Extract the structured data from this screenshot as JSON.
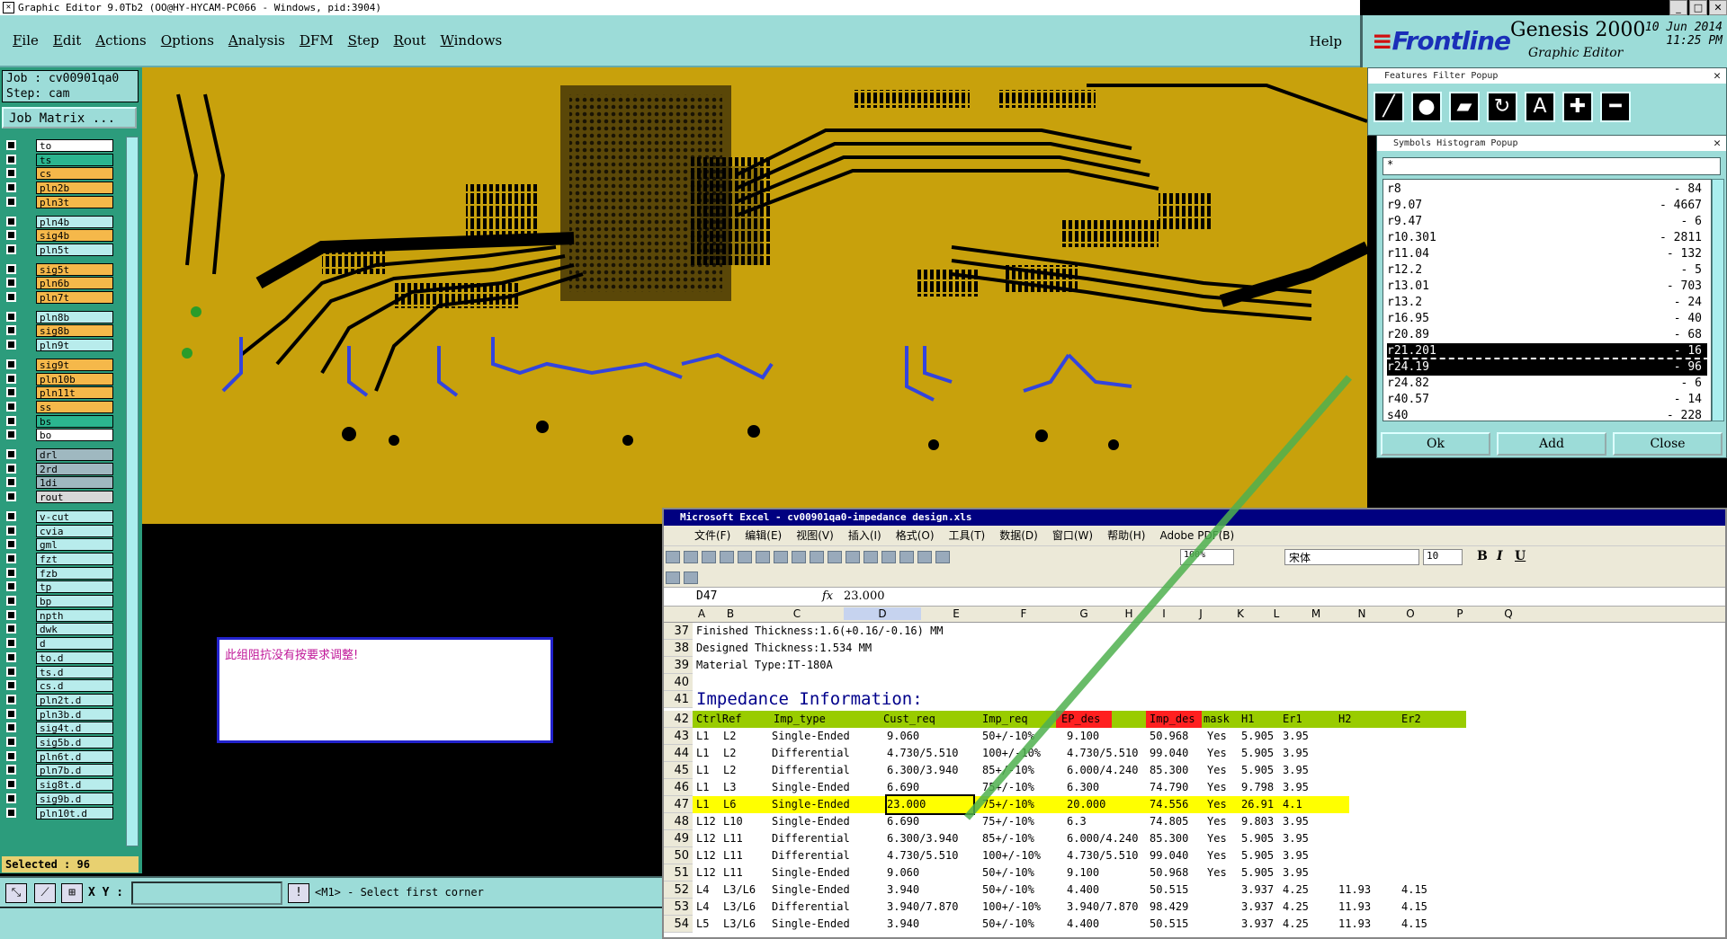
{
  "app": {
    "title": "Graphic Editor 9.0Tb2 (OO@HY-HYCAM-PC066 - Windows, pid:3904)",
    "menu": [
      "File",
      "Edit",
      "Actions",
      "Options",
      "Analysis",
      "DFM",
      "Step",
      "Rout",
      "Windows"
    ],
    "help": "Help"
  },
  "brand": {
    "logo": "Frontline",
    "product": "Genesis 2000",
    "subtitle": "Graphic Editor",
    "date": "10 Jun 2014",
    "time": "11:25 PM"
  },
  "job": {
    "job_label": "Job : cv00901qa0",
    "step_label": "Step: cam",
    "matrix_button": "Job Matrix ..."
  },
  "layers": [
    {
      "name": "to",
      "color": "#ffffff"
    },
    {
      "name": "ts",
      "color": "#2bb58f"
    },
    {
      "name": "cs",
      "color": "#f5b84a"
    },
    {
      "name": "pln2b",
      "color": "#f5b84a"
    },
    {
      "name": "pln3t",
      "color": "#f5b84a"
    },
    {
      "name": "pln4b",
      "color": "#b8ecec"
    },
    {
      "name": "sig4b",
      "color": "#f5b84a"
    },
    {
      "name": "pln5t",
      "color": "#b8ecec"
    },
    {
      "name": "sig5t",
      "color": "#f5b84a"
    },
    {
      "name": "pln6b",
      "color": "#f5b84a"
    },
    {
      "name": "pln7t",
      "color": "#f5b84a"
    },
    {
      "name": "pln8b",
      "color": "#b8ecec"
    },
    {
      "name": "sig8b",
      "color": "#f5b84a"
    },
    {
      "name": "pln9t",
      "color": "#b8ecec"
    },
    {
      "name": "sig9t",
      "color": "#f5b84a"
    },
    {
      "name": "pln10b",
      "color": "#f5b84a"
    },
    {
      "name": "pln11t",
      "color": "#f5b84a"
    },
    {
      "name": "ss",
      "color": "#f5b84a"
    },
    {
      "name": "bs",
      "color": "#2bb58f"
    },
    {
      "name": "bo",
      "color": "#ffffff"
    },
    {
      "name": "drl",
      "color": "#9fb8c0"
    },
    {
      "name": "2rd",
      "color": "#9fb8c0"
    },
    {
      "name": "1di",
      "color": "#9fb8c0"
    },
    {
      "name": "rout",
      "color": "#d8d8d8"
    },
    {
      "name": "v-cut",
      "color": "#b8ecec"
    },
    {
      "name": "cvia",
      "color": "#b8ecec"
    },
    {
      "name": "gml",
      "color": "#b8ecec"
    },
    {
      "name": "fzt",
      "color": "#b8ecec"
    },
    {
      "name": "fzb",
      "color": "#b8ecec"
    },
    {
      "name": "tp",
      "color": "#b8ecec"
    },
    {
      "name": "bp",
      "color": "#b8ecec"
    },
    {
      "name": "npth",
      "color": "#b8ecec"
    },
    {
      "name": "dwk",
      "color": "#b8ecec"
    },
    {
      "name": "d",
      "color": "#b8ecec"
    },
    {
      "name": "to.d",
      "color": "#b8ecec"
    },
    {
      "name": "ts.d",
      "color": "#b8ecec"
    },
    {
      "name": "cs.d",
      "color": "#b8ecec"
    },
    {
      "name": "pln2t.d",
      "color": "#b8ecec"
    },
    {
      "name": "pln3b.d",
      "color": "#b8ecec"
    },
    {
      "name": "sig4t.d",
      "color": "#b8ecec"
    },
    {
      "name": "sig5b.d",
      "color": "#b8ecec"
    },
    {
      "name": "pln6t.d",
      "color": "#b8ecec"
    },
    {
      "name": "pln7b.d",
      "color": "#b8ecec"
    },
    {
      "name": "sig8t.d",
      "color": "#b8ecec"
    },
    {
      "name": "sig9b.d",
      "color": "#b8ecec"
    },
    {
      "name": "pln10t.d",
      "color": "#b8ecec"
    }
  ],
  "selected": "Selected : 96",
  "bottom": {
    "xy_label": "X Y :",
    "message": "<M1> - Select first corner"
  },
  "note": "此组阻抗没有按要求调整!",
  "features_popup": {
    "title": "Features Filter Popup"
  },
  "symbols_popup": {
    "title": "Symbols Histogram Popup",
    "filter": "*",
    "rows": [
      {
        "sym": "r8",
        "count": "- 84"
      },
      {
        "sym": "r9.07",
        "count": "- 4667"
      },
      {
        "sym": "r9.47",
        "count": "- 6"
      },
      {
        "sym": "r10.301",
        "count": "- 2811"
      },
      {
        "sym": "r11.04",
        "count": "- 132"
      },
      {
        "sym": "r12.2",
        "count": "- 5"
      },
      {
        "sym": "r13.01",
        "count": "- 703"
      },
      {
        "sym": "r13.2",
        "count": "- 24"
      },
      {
        "sym": "r16.95",
        "count": "- 40"
      },
      {
        "sym": "r20.89",
        "count": "- 68"
      },
      {
        "sym": "r21.201",
        "count": "- 16"
      },
      {
        "sym": "r24.19",
        "count": "- 96"
      },
      {
        "sym": "r24.82",
        "count": "- 6"
      },
      {
        "sym": "r40.57",
        "count": "- 14"
      },
      {
        "sym": "s40",
        "count": "- 228"
      }
    ],
    "buttons": [
      "Ok",
      "Add",
      "Close"
    ]
  },
  "excel": {
    "title": "Microsoft Excel - cv00901qa0-impedance design.xls",
    "menu": [
      "文件(F)",
      "编辑(E)",
      "视图(V)",
      "插入(I)",
      "格式(O)",
      "工具(T)",
      "数据(D)",
      "窗口(W)",
      "帮助(H)",
      "Adobe PDF(B)"
    ],
    "zoom": "100%",
    "font": "宋体",
    "size": "10",
    "namebox": "D47",
    "formula": "23.000",
    "columns": [
      "A",
      "B",
      "C",
      "D",
      "E",
      "F",
      "G",
      "H",
      "I",
      "J",
      "K",
      "L",
      "M",
      "N",
      "O",
      "P",
      "Q"
    ],
    "info": [
      {
        "n": "37",
        "t": "Finished Thickness:1.6(+0.16/-0.16) MM"
      },
      {
        "n": "38",
        "t": "Designed Thickness:1.534 MM"
      },
      {
        "n": "39",
        "t": "Material Type:IT-180A"
      },
      {
        "n": "40",
        "t": ""
      }
    ],
    "imp_row": {
      "n": "41",
      "t": "Impedance Information:"
    },
    "header": {
      "n": "42",
      "cells": [
        "CtrlRef",
        "Imp_type",
        "Cust_req",
        "Imp_req",
        "EP_des",
        "Imp_des",
        "mask",
        "H1",
        "Er1",
        "H2",
        "Er2"
      ]
    },
    "data": [
      {
        "n": "43",
        "c": [
          "L1",
          "L2",
          "Single-Ended",
          "9.060",
          "50+/-10%",
          "9.100",
          "50.968",
          "Yes",
          "5.905",
          "3.95",
          "",
          ""
        ]
      },
      {
        "n": "44",
        "c": [
          "L1",
          "L2",
          "Differential",
          "4.730/5.510",
          "100+/-10%",
          "4.730/5.510",
          "99.040",
          "Yes",
          "5.905",
          "3.95",
          "",
          ""
        ]
      },
      {
        "n": "45",
        "c": [
          "L1",
          "L2",
          "Differential",
          "6.300/3.940",
          "85+/-10%",
          "6.000/4.240",
          "85.300",
          "Yes",
          "5.905",
          "3.95",
          "",
          ""
        ]
      },
      {
        "n": "46",
        "c": [
          "L1",
          "L3",
          "Single-Ended",
          "6.690",
          "75+/-10%",
          "6.300",
          "74.790",
          "Yes",
          "9.798",
          "3.95",
          "",
          ""
        ]
      },
      {
        "n": "47",
        "c": [
          "L1",
          "L6",
          "Single-Ended",
          "23.000",
          "75+/-10%",
          "20.000",
          "74.556",
          "Yes",
          "26.91",
          "4.1",
          "",
          ""
        ]
      },
      {
        "n": "48",
        "c": [
          "L12",
          "L10",
          "Single-Ended",
          "6.690",
          "75+/-10%",
          "6.3",
          "74.805",
          "Yes",
          "9.803",
          "3.95",
          "",
          ""
        ]
      },
      {
        "n": "49",
        "c": [
          "L12",
          "L11",
          "Differential",
          "6.300/3.940",
          "85+/-10%",
          "6.000/4.240",
          "85.300",
          "Yes",
          "5.905",
          "3.95",
          "",
          ""
        ]
      },
      {
        "n": "50",
        "c": [
          "L12",
          "L11",
          "Differential",
          "4.730/5.510",
          "100+/-10%",
          "4.730/5.510",
          "99.040",
          "Yes",
          "5.905",
          "3.95",
          "",
          ""
        ]
      },
      {
        "n": "51",
        "c": [
          "L12",
          "L11",
          "Single-Ended",
          "9.060",
          "50+/-10%",
          "9.100",
          "50.968",
          "Yes",
          "5.905",
          "3.95",
          "",
          ""
        ]
      },
      {
        "n": "52",
        "c": [
          "L4",
          "L3/L6",
          "Single-Ended",
          "3.940",
          "50+/-10%",
          "4.400",
          "50.515",
          "",
          "3.937",
          "4.25",
          "11.93",
          "4.15"
        ]
      },
      {
        "n": "53",
        "c": [
          "L4",
          "L3/L6",
          "Differential",
          "3.940/7.870",
          "100+/-10%",
          "3.940/7.870",
          "98.429",
          "",
          "3.937",
          "4.25",
          "11.93",
          "4.15"
        ]
      },
      {
        "n": "54",
        "c": [
          "L5",
          "L3/L6",
          "Single-Ended",
          "3.940",
          "50+/-10%",
          "4.400",
          "50.515",
          "",
          "3.937",
          "4.25",
          "11.93",
          "4.15"
        ]
      }
    ]
  }
}
